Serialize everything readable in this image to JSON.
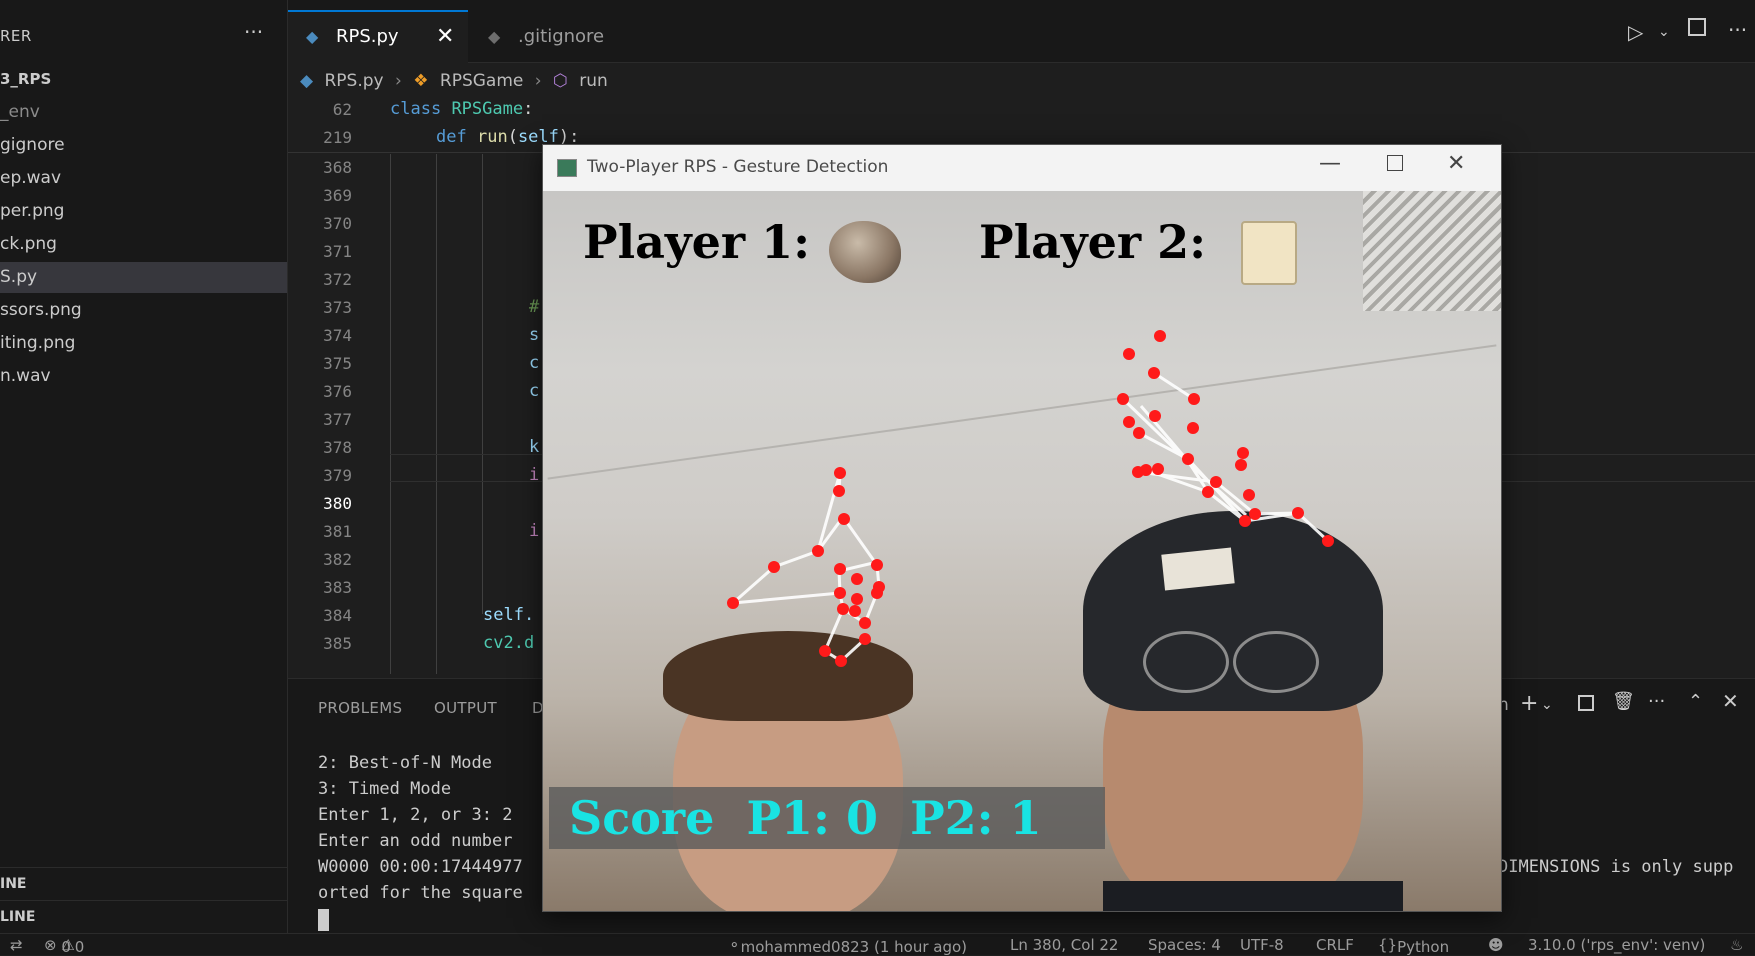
{
  "sidebar": {
    "title": "RER",
    "more": "···",
    "items": [
      {
        "label": "3_RPS",
        "kind": "folder"
      },
      {
        "label": "_env",
        "kind": "dim"
      },
      {
        "label": "gignore",
        "kind": "file"
      },
      {
        "label": "ep.wav",
        "kind": "file"
      },
      {
        "label": "per.png",
        "kind": "file"
      },
      {
        "label": "ck.png",
        "kind": "file"
      },
      {
        "label": "S.py",
        "kind": "selected"
      },
      {
        "label": "ssors.png",
        "kind": "file"
      },
      {
        "label": "iting.png",
        "kind": "file"
      },
      {
        "label": "n.wav",
        "kind": "file"
      }
    ],
    "sections": [
      "INE",
      "LINE"
    ]
  },
  "tabs": [
    {
      "label": "RPS.py",
      "icon": "python-file-icon"
    },
    {
      "label": ".gitignore",
      "icon": "git-diamond-icon"
    }
  ],
  "breadcrumb": {
    "file": "RPS.py",
    "class": "RPSGame",
    "method": "run"
  },
  "editor": {
    "sticky": [
      {
        "ln": "62",
        "code": "class RPSGame:"
      },
      {
        "ln": "219",
        "code": "def run(self):"
      }
    ],
    "line_numbers": [
      "368",
      "369",
      "370",
      "371",
      "372",
      "373",
      "374",
      "375",
      "376",
      "377",
      "378",
      "379",
      "380",
      "381",
      "382",
      "383",
      "384",
      "385"
    ],
    "current_line": "380",
    "fragments": {
      "373": "#",
      "374": "s",
      "375": "c",
      "376": "c",
      "378": "k",
      "379": "i",
      "381": "i",
      "384": "self.",
      "385": "cv2.d"
    }
  },
  "panel": {
    "tabs": [
      "PROBLEMS",
      "OUTPUT",
      "D"
    ],
    "terminal_lines": [
      "2: Best-of-N Mode",
      "3: Timed Mode",
      "Enter 1, 2, or 3: 2",
      "Enter an odd number",
      "W0000 00:00:17444977",
      "orted for the square"
    ],
    "right_text": "DIMENSIONS is only supp",
    "right_label": "n"
  },
  "statusbar": {
    "errors": "0",
    "warnings": "0",
    "git": "mohammed0823 (1 hour ago)",
    "position": "Ln 380, Col 22",
    "spaces": "Spaces: 4",
    "encoding": "UTF-8",
    "eol": "CRLF",
    "language": "Python",
    "interpreter": "3.10.0 ('rps_env': venv)"
  },
  "cv_window": {
    "title": "Two-Player RPS - Gesture Detection",
    "player1_label": "Player 1:",
    "player2_label": "Player 2:",
    "player1_choice_icon": "rock-icon",
    "player2_choice_icon": "paper-icon",
    "score_text": "Score  P1: 0  P2: 1",
    "colors": {
      "score": "#19e3e3",
      "landmark": "#ff0000"
    }
  }
}
